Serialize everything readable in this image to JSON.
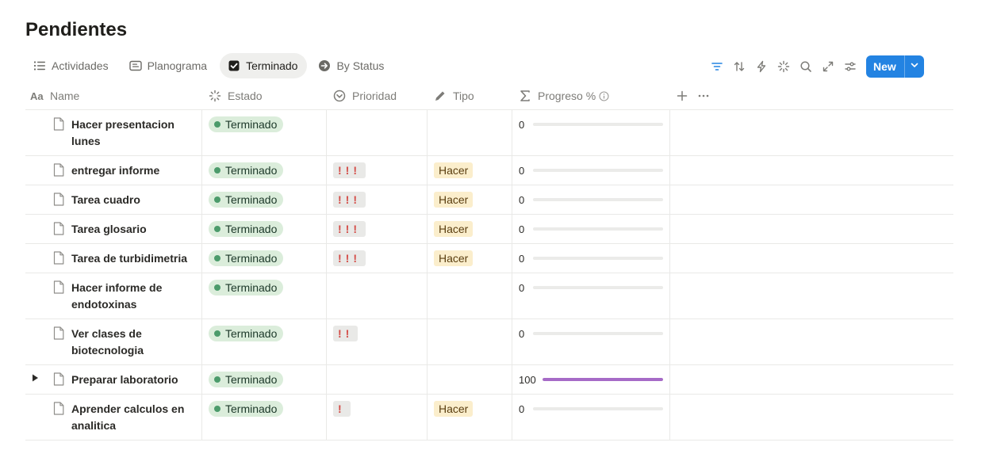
{
  "page": {
    "title": "Pendientes"
  },
  "views": [
    {
      "label": "Actividades",
      "icon": "list-icon",
      "active": false
    },
    {
      "label": "Planograma",
      "icon": "board-icon",
      "active": false
    },
    {
      "label": "Terminado",
      "icon": "checkbox-icon",
      "active": true
    },
    {
      "label": "By Status",
      "icon": "arrow-circle-icon",
      "active": false
    }
  ],
  "toolbar": {
    "new_label": "New",
    "accent": "#2383e2",
    "icons": [
      "filter-icon",
      "sort-icon",
      "lightning-icon",
      "sparkle-icon",
      "search-icon",
      "expand-icon",
      "settings-sliders-icon"
    ]
  },
  "columns": {
    "name": "Name",
    "estado": "Estado",
    "prioridad": "Prioridad",
    "tipo": "Tipo",
    "progreso": "Progreso %"
  },
  "colors": {
    "status_bg": "#dbeddb",
    "status_dot": "#4c9b6b",
    "priority": "#d44c47",
    "tipo_bg": "#fbeecc",
    "progress_fill": "#a66bc7"
  },
  "rows": [
    {
      "name": "Hacer presentacion lunes",
      "estado": "Terminado",
      "prioridad": "",
      "tipo": "",
      "progreso": 0,
      "expandable": false,
      "tall": true
    },
    {
      "name": "entregar informe",
      "estado": "Terminado",
      "prioridad": "!!!",
      "tipo": "Hacer",
      "progreso": 0,
      "expandable": false,
      "tall": false
    },
    {
      "name": "Tarea cuadro",
      "estado": "Terminado",
      "prioridad": "!!!",
      "tipo": "Hacer",
      "progreso": 0,
      "expandable": false,
      "tall": false
    },
    {
      "name": "Tarea glosario",
      "estado": "Terminado",
      "prioridad": "!!!",
      "tipo": "Hacer",
      "progreso": 0,
      "expandable": false,
      "tall": false
    },
    {
      "name": "Tarea de turbidimetria",
      "estado": "Terminado",
      "prioridad": "!!!",
      "tipo": "Hacer",
      "progreso": 0,
      "expandable": false,
      "tall": false
    },
    {
      "name": "Hacer informe de endotoxinas",
      "estado": "Terminado",
      "prioridad": "",
      "tipo": "",
      "progreso": 0,
      "expandable": false,
      "tall": true
    },
    {
      "name": "Ver clases de biotecnologia",
      "estado": "Terminado",
      "prioridad": "!!",
      "tipo": "",
      "progreso": 0,
      "expandable": false,
      "tall": true
    },
    {
      "name": "Preparar laboratorio",
      "estado": "Terminado",
      "prioridad": "",
      "tipo": "",
      "progreso": 100,
      "expandable": true,
      "tall": false
    },
    {
      "name": "Aprender calculos en analitica",
      "estado": "Terminado",
      "prioridad": "!",
      "tipo": "Hacer",
      "progreso": 0,
      "expandable": false,
      "tall": true
    }
  ]
}
